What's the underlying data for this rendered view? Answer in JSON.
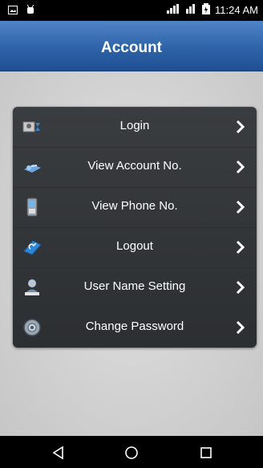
{
  "status_bar": {
    "time": "11:24 AM",
    "icons": [
      "image-icon",
      "android-debug-icon",
      "signal-icon",
      "signal-icon",
      "battery-icon"
    ]
  },
  "header": {
    "title": "Account"
  },
  "menu": {
    "items": [
      {
        "label": "Login",
        "icon": "login-icon"
      },
      {
        "label": "View Account No.",
        "icon": "account-number-icon"
      },
      {
        "label": "View Phone No.",
        "icon": "phone-icon"
      },
      {
        "label": "Logout",
        "icon": "logout-icon"
      },
      {
        "label": "User Name Setting",
        "icon": "user-settings-icon"
      },
      {
        "label": "Change Password",
        "icon": "password-icon"
      }
    ]
  },
  "nav_bar": {
    "buttons": [
      "back-icon",
      "home-icon",
      "recents-icon"
    ]
  },
  "colors": {
    "header": "#2e63a8",
    "menu_bg": "#333638",
    "text": "#ffffff"
  }
}
